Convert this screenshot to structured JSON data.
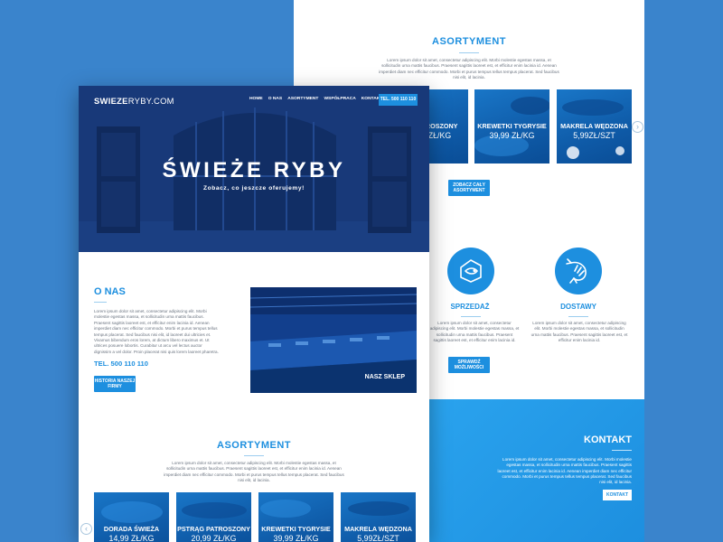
{
  "site": {
    "logo_bold": "SWIEZE",
    "logo_light": "RYBY.COM"
  },
  "nav": {
    "items": [
      "HOME",
      "O NAS",
      "ASORTYMENT",
      "WSPÓŁPRACA",
      "KONTAKT"
    ],
    "phone_button": "TEL. 500 110 110"
  },
  "hero": {
    "title": "ŚWIEŻE RYBY",
    "subtitle": "Zobacz, co jeszcze oferujemy!"
  },
  "about": {
    "title": "O NAS",
    "text": "Lorem ipsum dolor sit amet, consectetur adipiscing elit. Morbi molestie egestas massa, et sollicitudin urna mattis faucibus. Praesent sagittis laoreet est, et efficitur enim lacinia id. Aenean imperdiet diam nec efficitur commodo. Morbi et purus tempus tellus tempus placerat. Sed faucibus nisi elit, id laoreet dui ultricies et. Vivamus bibendum eros lorem, at dictum libero maximus et. Ut ultrices posuere lobortis. Curabitur ut arcu vel lectus auctor dignissim a vel dolor. Proin placerat nisi quis lorem laoreet pharetra.",
    "phone": "TEL. 500 110 110",
    "button": "HISTORIA NASZEJ FIRMY",
    "shop_label": "NASZ SKLEP"
  },
  "assortment": {
    "title": "ASORTYMENT",
    "text": "Lorem ipsum dolor sit amet, consectetur adipiscing elit. Morbi molestie egestas massa, et sollicitudin urna mattis faucibus. Praesent sagittis laoreet est, et efficitur enim lacinia id. Aenean imperdiet diam nec efficitur commodo. Morbi et purus tempus tellus tempus placerat. Sed faucibus nisi elit, id lacinia.",
    "products": [
      {
        "name": "DORADA ŚWIEŻA",
        "price": "14,99 ZŁ/KG"
      },
      {
        "name": "PSTRĄG PATROSZONY",
        "price": "20,99 ZŁ/KG"
      },
      {
        "name": "KREWETKI TYGRYSIE",
        "price": "39,99 ZŁ/KG"
      },
      {
        "name": "MAKRELA WĘDZONA",
        "price": "5,99ZŁ/SZT"
      }
    ],
    "back_partial_name": "TROSZONY",
    "back_partial_price": "ZŁ/KG",
    "button": "ZOBACZ CAŁY ASORTYMENT"
  },
  "features": {
    "items": [
      {
        "title": "SPRZEDAŻ",
        "icon": "fish-sale-icon"
      },
      {
        "title": "DOSTAWY",
        "icon": "shrimp-icon"
      }
    ],
    "text": "Lorem ipsum dolor sit amet, consectetur adipiscing elit. Morbi molestie egestas massa, et sollicitudin urna mattis faucibus. Praesent sagittis laoreet est, et efficitur enim lacinia id.",
    "button": "SPRAWDŹ MOŻLIWOŚCI"
  },
  "contact": {
    "title": "KONTAKT",
    "text": "Lorem ipsum dolor sit amet, consectetur adipiscing elit. Morbi molestie egestas massa, et sollicitudin urna mattis faucibus. Praesent sagittis laoreet est, et efficitur enim lacinia id. Aenean imperdiet diam nec efficitur commodo. Morbi et purus tempus tellus tempus placerat. Sed faucibus nisi elit, id lacinia.",
    "button": "KONTAKT"
  },
  "colors": {
    "accent": "#1d8fdf",
    "background": "#3a84cc",
    "hero": "#152f66"
  }
}
